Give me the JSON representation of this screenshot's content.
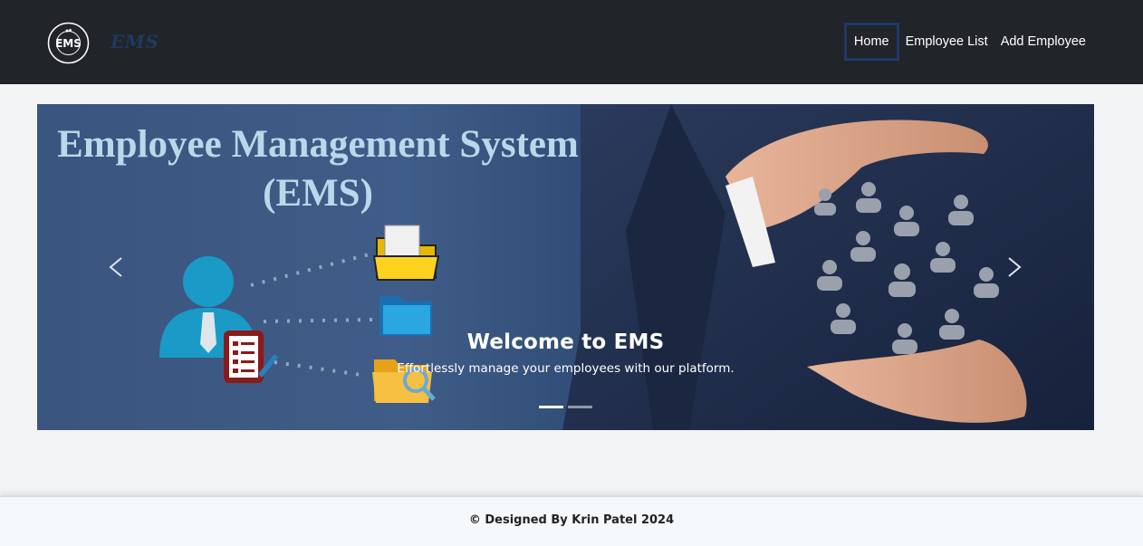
{
  "navbar": {
    "brand": "EMS",
    "logo_text": "EMS",
    "links": [
      {
        "label": "Home",
        "active": true
      },
      {
        "label": "Employee List",
        "active": false
      },
      {
        "label": "Add Employee",
        "active": false
      }
    ],
    "colors": {
      "background": "#212529",
      "active_border": "#1f3a68",
      "brand": "#1e3a5f"
    }
  },
  "carousel": {
    "banner_title_line1": "Employee Management System",
    "banner_title_line2": "(EMS)",
    "caption_title": "Welcome to EMS",
    "caption_text": "Effortlessly manage your employees with our platform.",
    "prev_icon": "chevron-left-icon",
    "next_icon": "chevron-right-icon",
    "slide_count": 2,
    "active_slide": 1
  },
  "footer": {
    "text": "© Designed By Krin Patel 2024"
  }
}
